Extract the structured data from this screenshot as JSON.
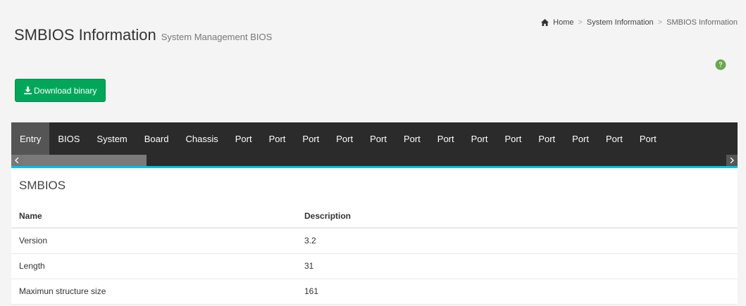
{
  "header": {
    "title": "SMBIOS Information",
    "subtitle": "System Management BIOS"
  },
  "breadcrumb": {
    "home": "Home",
    "parent": "System Information",
    "current": "SMBIOS Information",
    "separator": ">"
  },
  "toolbar": {
    "download_label": "Download binary"
  },
  "tabs": [
    {
      "label": "Entry",
      "active": true
    },
    {
      "label": "BIOS"
    },
    {
      "label": "System"
    },
    {
      "label": "Board"
    },
    {
      "label": "Chassis"
    },
    {
      "label": "Port"
    },
    {
      "label": "Port"
    },
    {
      "label": "Port"
    },
    {
      "label": "Port"
    },
    {
      "label": "Port"
    },
    {
      "label": "Port"
    },
    {
      "label": "Port"
    },
    {
      "label": "Port"
    },
    {
      "label": "Port"
    },
    {
      "label": "Port"
    },
    {
      "label": "Port"
    },
    {
      "label": "Port"
    },
    {
      "label": "Port"
    }
  ],
  "section": {
    "title": "SMBIOS",
    "columns": {
      "name": "Name",
      "description": "Description"
    },
    "rows": [
      {
        "name": "Version",
        "description": "3.2"
      },
      {
        "name": "Length",
        "description": "31"
      },
      {
        "name": "Maximun structure size",
        "description": "161"
      }
    ]
  },
  "colors": {
    "accent_green": "#00a65a",
    "tab_bar_bg": "#2b2b2b",
    "box_border": "#00c0ef",
    "help_icon": "#6aa84f"
  },
  "icons": {
    "home": "home-icon",
    "download": "download-icon",
    "help": "question-circle-icon"
  }
}
